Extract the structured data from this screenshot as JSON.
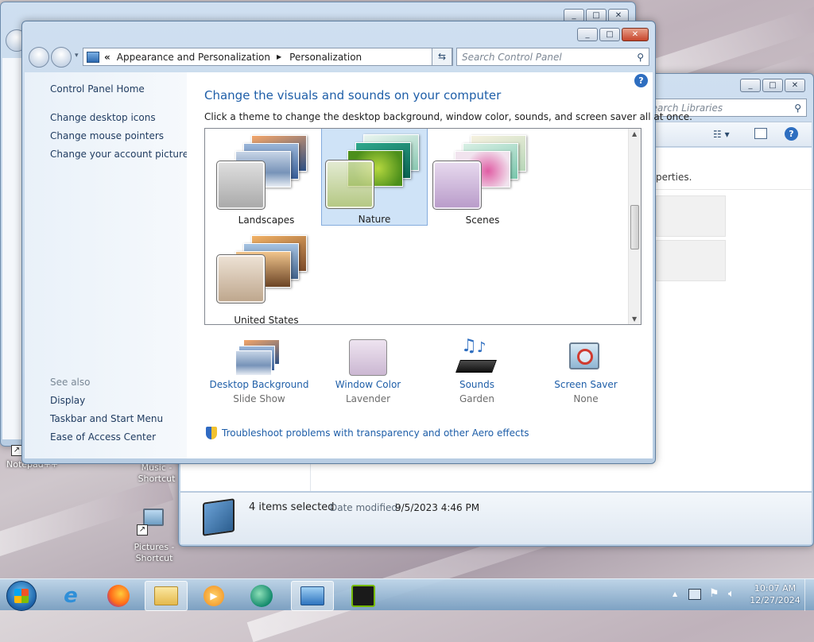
{
  "desktop": {
    "icons": [
      {
        "label": "Notepad++"
      },
      {
        "label": "Music - Shortcut"
      },
      {
        "label": "Pictures - Shortcut"
      }
    ]
  },
  "explorer": {
    "search_placeholder": "Search Libraries",
    "properties_text": "perties.",
    "status_count": "4 items selected",
    "date_label": "Date modified:",
    "date_value": "9/5/2023 4:46 PM"
  },
  "personalization": {
    "breadcrumb": {
      "chevrons": "«",
      "parent": "Appearance and Personalization",
      "separator": "▶",
      "current": "Personalization"
    },
    "search_placeholder": "Search Control Panel",
    "sidebar": {
      "home": "Control Panel Home",
      "links": [
        "Change desktop icons",
        "Change mouse pointers",
        "Change your account picture"
      ],
      "see_also_header": "See also",
      "see_also": [
        "Display",
        "Taskbar and Start Menu",
        "Ease of Access Center"
      ]
    },
    "heading": "Change the visuals and sounds on your computer",
    "subheading": "Click a theme to change the desktop background, window color, sounds, and screen saver all at once.",
    "themes": [
      {
        "name": "Landscapes",
        "selected": false
      },
      {
        "name": "Nature",
        "selected": true
      },
      {
        "name": "Scenes",
        "selected": false
      },
      {
        "name": "United States",
        "selected": false
      }
    ],
    "settings": [
      {
        "label": "Desktop Background",
        "value": "Slide Show",
        "icon": "desktop-background-icon"
      },
      {
        "label": "Window Color",
        "value": "Lavender",
        "icon": "window-color-icon"
      },
      {
        "label": "Sounds",
        "value": "Garden",
        "icon": "sounds-icon"
      },
      {
        "label": "Screen Saver",
        "value": "None",
        "icon": "screen-saver-icon"
      }
    ],
    "troubleshoot": "Troubleshoot problems with transparency and other Aero effects"
  },
  "taskbar": {
    "time": "10:07 AM",
    "date": "12/27/2024"
  },
  "colors": {
    "accent": "#1e5ea8",
    "heading": "#1e5ea8",
    "selected_theme": "#cfe3f7"
  }
}
